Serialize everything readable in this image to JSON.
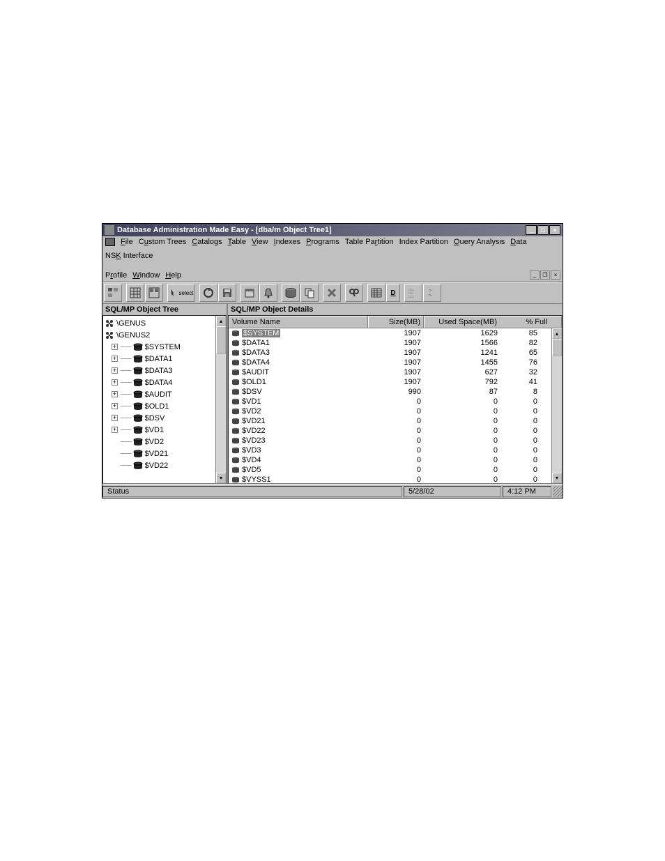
{
  "window": {
    "title": "Database Administration Made Easy - [dba/m Object Tree1]"
  },
  "menu": {
    "file": "File",
    "custom_trees": "Custom Trees",
    "catalogs": "Catalogs",
    "table": "Table",
    "view": "View",
    "indexes": "Indexes",
    "programs": "Programs",
    "table_partition": "Table Partition",
    "index_partition": "Index Partition",
    "query_analysis": "Query Analysis",
    "data": "Data",
    "nsk_interface": "NSK Interface",
    "profile": "Profile",
    "window": "Window",
    "help": "Help"
  },
  "toolbar": {
    "select_label": "select"
  },
  "tree": {
    "header": "SQL/MP Object Tree",
    "items": [
      {
        "type": "node",
        "label": "\\GENUS",
        "expander": null,
        "icon": "node"
      },
      {
        "type": "node",
        "label": "\\GENUS2",
        "expander": null,
        "icon": "node"
      },
      {
        "type": "disk",
        "label": "$SYSTEM",
        "expander": "+",
        "icon": "disk"
      },
      {
        "type": "disk",
        "label": "$DATA1",
        "expander": "+",
        "icon": "disk"
      },
      {
        "type": "disk",
        "label": "$DATA3",
        "expander": "+",
        "icon": "disk"
      },
      {
        "type": "disk",
        "label": "$DATA4",
        "expander": "+",
        "icon": "disk"
      },
      {
        "type": "disk",
        "label": "$AUDIT",
        "expander": "+",
        "icon": "disk"
      },
      {
        "type": "disk",
        "label": "$OLD1",
        "expander": "+",
        "icon": "disk"
      },
      {
        "type": "disk",
        "label": "$DSV",
        "expander": "+",
        "icon": "disk"
      },
      {
        "type": "disk",
        "label": "$VD1",
        "expander": "+",
        "icon": "disk"
      },
      {
        "type": "disk",
        "label": "$VD2",
        "expander": null,
        "icon": "disk"
      },
      {
        "type": "disk",
        "label": "$VD21",
        "expander": null,
        "icon": "disk"
      },
      {
        "type": "disk",
        "label": "$VD22",
        "expander": null,
        "icon": "disk"
      }
    ]
  },
  "details": {
    "header": "SQL/MP Object Details",
    "columns": {
      "name": "Volume Name",
      "size": "Size(MB)",
      "used": "Used Space(MB)",
      "full": "% Full"
    },
    "rows": [
      {
        "name": "$SYSTEM",
        "size": "1907",
        "used": "1629",
        "full": "85",
        "selected": true
      },
      {
        "name": "$DATA1",
        "size": "1907",
        "used": "1566",
        "full": "82",
        "selected": false
      },
      {
        "name": "$DATA3",
        "size": "1907",
        "used": "1241",
        "full": "65",
        "selected": false
      },
      {
        "name": "$DATA4",
        "size": "1907",
        "used": "1455",
        "full": "76",
        "selected": false
      },
      {
        "name": "$AUDIT",
        "size": "1907",
        "used": "627",
        "full": "32",
        "selected": false
      },
      {
        "name": "$OLD1",
        "size": "1907",
        "used": "792",
        "full": "41",
        "selected": false
      },
      {
        "name": "$DSV",
        "size": "990",
        "used": "87",
        "full": "8",
        "selected": false
      },
      {
        "name": "$VD1",
        "size": "0",
        "used": "0",
        "full": "0",
        "selected": false
      },
      {
        "name": "$VD2",
        "size": "0",
        "used": "0",
        "full": "0",
        "selected": false
      },
      {
        "name": "$VD21",
        "size": "0",
        "used": "0",
        "full": "0",
        "selected": false
      },
      {
        "name": "$VD22",
        "size": "0",
        "used": "0",
        "full": "0",
        "selected": false
      },
      {
        "name": "$VD23",
        "size": "0",
        "used": "0",
        "full": "0",
        "selected": false
      },
      {
        "name": "$VD3",
        "size": "0",
        "used": "0",
        "full": "0",
        "selected": false
      },
      {
        "name": "$VD4",
        "size": "0",
        "used": "0",
        "full": "0",
        "selected": false
      },
      {
        "name": "$VD5",
        "size": "0",
        "used": "0",
        "full": "0",
        "selected": false
      },
      {
        "name": "$VYSS1",
        "size": "0",
        "used": "0",
        "full": "0",
        "selected": false
      }
    ]
  },
  "status": {
    "label": "Status",
    "date": "5/28/02",
    "time": "4:12 PM"
  }
}
